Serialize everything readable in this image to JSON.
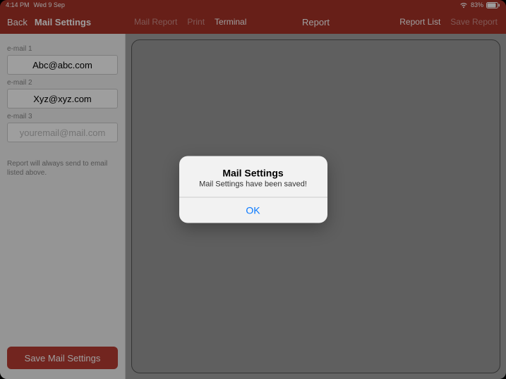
{
  "status": {
    "time": "4:14 PM",
    "date": "Wed 9 Sep",
    "battery": "83%"
  },
  "nav": {
    "back": "Back",
    "title": "Mail Settings",
    "items": {
      "mail_report": "Mail Report",
      "print": "Print",
      "terminal": "Terminal"
    },
    "center": "Report",
    "right": {
      "report_list": "Report List",
      "save_report": "Save Report"
    }
  },
  "sidebar": {
    "labels": {
      "email1": "e-mail 1",
      "email2": "e-mail 2",
      "email3": "e-mail 3"
    },
    "values": {
      "email1": "Abc@abc.com",
      "email2": "Xyz@xyz.com",
      "email3": ""
    },
    "placeholder": "youremail@mail.com",
    "helper": "Report will always send to email listed above.",
    "save_btn": "Save Mail Settings"
  },
  "alert": {
    "title": "Mail Settings",
    "message": "Mail Settings have been saved!",
    "ok": "OK"
  }
}
